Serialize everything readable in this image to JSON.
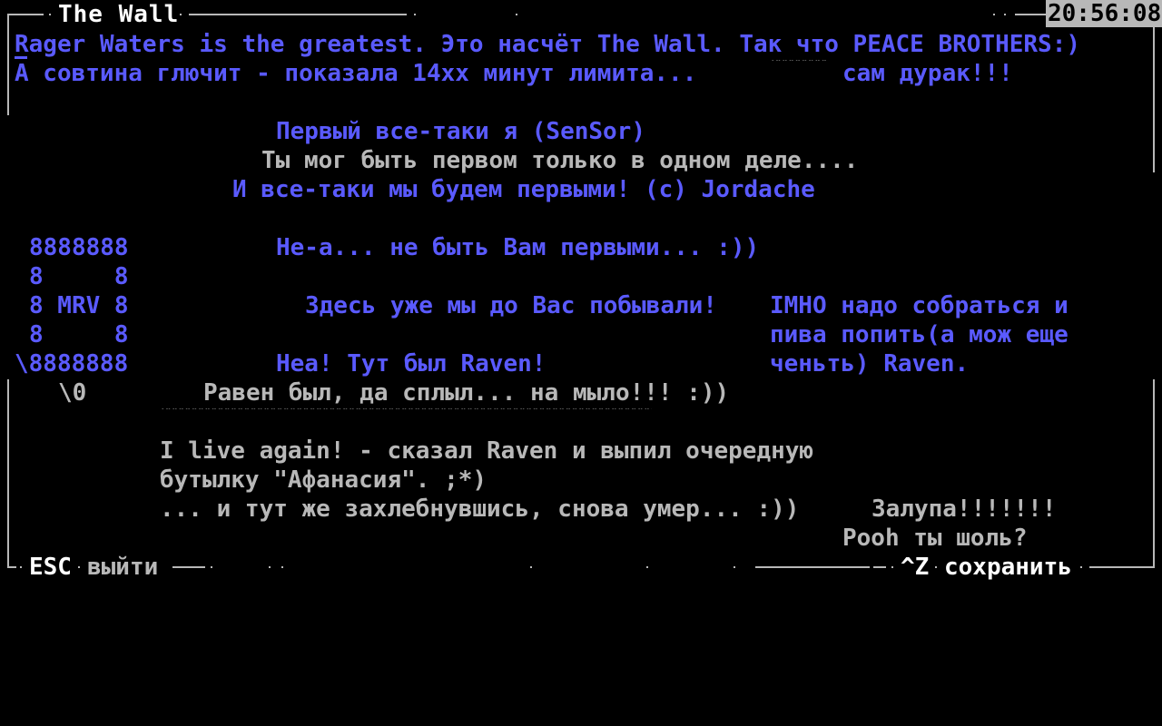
{
  "window": {
    "title": "The Wall",
    "clock": "20:56:08"
  },
  "lines": [
    {
      "text": "Rager Waters is the greatest. Это насчёт The Wall. Так что PEACE BROTHERS:)",
      "color": "#5a5aff"
    },
    {
      "text": "А совтина глючит - показала 14хх минут лимита...",
      "color": "#5a5aff"
    },
    {
      "text": "сам дурак!!!",
      "color": "#5a5aff"
    },
    {
      "text": "Первый все-таки я (SenSor)",
      "color": "#5a5aff"
    },
    {
      "text": "Ты мог быть первом только в одном деле....",
      "color": "#b8b8b8"
    },
    {
      "text": "И все-таки мы будем первыми! (c) Jordache",
      "color": "#5a5aff"
    },
    {
      "text": "8888888",
      "color": "#5a5aff"
    },
    {
      "text": "Не-а... не быть Вам первыми... :))",
      "color": "#5a5aff"
    },
    {
      "text": "8     8",
      "color": "#5a5aff"
    },
    {
      "text": "8 MRV 8",
      "color": "#5a5aff"
    },
    {
      "text": "Здесь уже мы до Вас побывали!",
      "color": "#5a5aff"
    },
    {
      "text": "IMHO надо собраться и",
      "color": "#5a5aff"
    },
    {
      "text": "8     8",
      "color": "#5a5aff"
    },
    {
      "text": "пива попить(а мож еще",
      "color": "#5a5aff"
    },
    {
      "text": "\\8888888",
      "color": "#5a5aff"
    },
    {
      "text": "Неа! Тут был Raven!",
      "color": "#5a5aff"
    },
    {
      "text": "ченьть) Raven.",
      "color": "#5a5aff"
    },
    {
      "text": "\\0",
      "color": "#b8b8b8"
    },
    {
      "text": "Равен был, да сплыл... на мыло!!! :))",
      "color": "#b8b8b8"
    },
    {
      "text": "I live again! - сказал Raven и выпил очередную",
      "color": "#b8b8b8"
    },
    {
      "text": "бутылку \"Афанасия\". ;*)",
      "color": "#b8b8b8"
    },
    {
      "text": "... и тут же захлебнувшись, снова умер... :))",
      "color": "#b8b8b8"
    },
    {
      "text": "Залупа!!!!!!!",
      "color": "#b8b8b8"
    },
    {
      "text": "Pooh ты шоль?",
      "color": "#b8b8b8"
    }
  ],
  "footer": {
    "exit_key": "ESC",
    "exit_label": "выйти",
    "save_key": "^Z",
    "save_label": "сохранить"
  }
}
